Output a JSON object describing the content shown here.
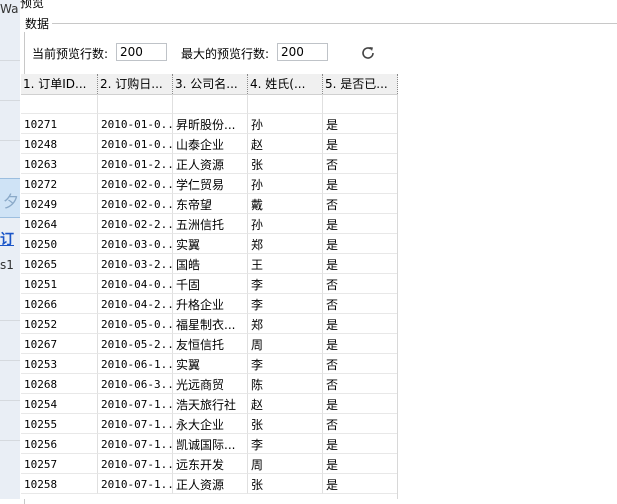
{
  "background_window": {
    "frag_top": "Wa",
    "frag_mid": "s1"
  },
  "dialog": {
    "title": "预览",
    "group_title": "数据",
    "current_rows_label": "当前预览行数:",
    "current_rows_value": "200",
    "max_rows_label": "最大的预览行数:",
    "max_rows_value": "200",
    "refresh_icon": "refresh-icon"
  },
  "table": {
    "columns": [
      "1. 订单ID...",
      "2. 订购日...",
      "3. 公司名...",
      "4. 姓氏(...",
      "5. 是否已..."
    ],
    "rows": [
      [
        "",
        "",
        "",
        "",
        ""
      ],
      [
        "10271",
        "2010-01-0...",
        "昇昕股份...",
        "孙",
        "是"
      ],
      [
        "10248",
        "2010-01-0...",
        "山泰企业",
        "赵",
        "是"
      ],
      [
        "10263",
        "2010-01-2...",
        "正人资源",
        "张",
        "否"
      ],
      [
        "10272",
        "2010-02-0...",
        "学仁贸易",
        "孙",
        "是"
      ],
      [
        "10249",
        "2010-02-0...",
        "东帝望",
        "戴",
        "否"
      ],
      [
        "10264",
        "2010-02-2...",
        "五洲信托",
        "孙",
        "是"
      ],
      [
        "10250",
        "2010-03-0...",
        "实翼",
        "郑",
        "是"
      ],
      [
        "10265",
        "2010-03-2...",
        "国皓",
        "王",
        "是"
      ],
      [
        "10251",
        "2010-04-0...",
        "千固",
        "李",
        "否"
      ],
      [
        "10266",
        "2010-04-2...",
        "升格企业",
        "李",
        "否"
      ],
      [
        "10252",
        "2010-05-0...",
        "福星制衣...",
        "郑",
        "是"
      ],
      [
        "10267",
        "2010-05-2...",
        "友恒信托",
        "周",
        "是"
      ],
      [
        "10253",
        "2010-06-1...",
        "实翼",
        "李",
        "否"
      ],
      [
        "10268",
        "2010-06-3...",
        "光远商贸",
        "陈",
        "否"
      ],
      [
        "10254",
        "2010-07-1...",
        "浩天旅行社",
        "赵",
        "是"
      ],
      [
        "10255",
        "2010-07-1...",
        "永大企业",
        "张",
        "否"
      ],
      [
        "10256",
        "2010-07-1...",
        "凯诚国际...",
        "李",
        "是"
      ],
      [
        "10257",
        "2010-07-1...",
        "远东开发",
        "周",
        "是"
      ],
      [
        "10258",
        "2010-07-1...",
        "正人资源",
        "张",
        "是"
      ]
    ]
  }
}
